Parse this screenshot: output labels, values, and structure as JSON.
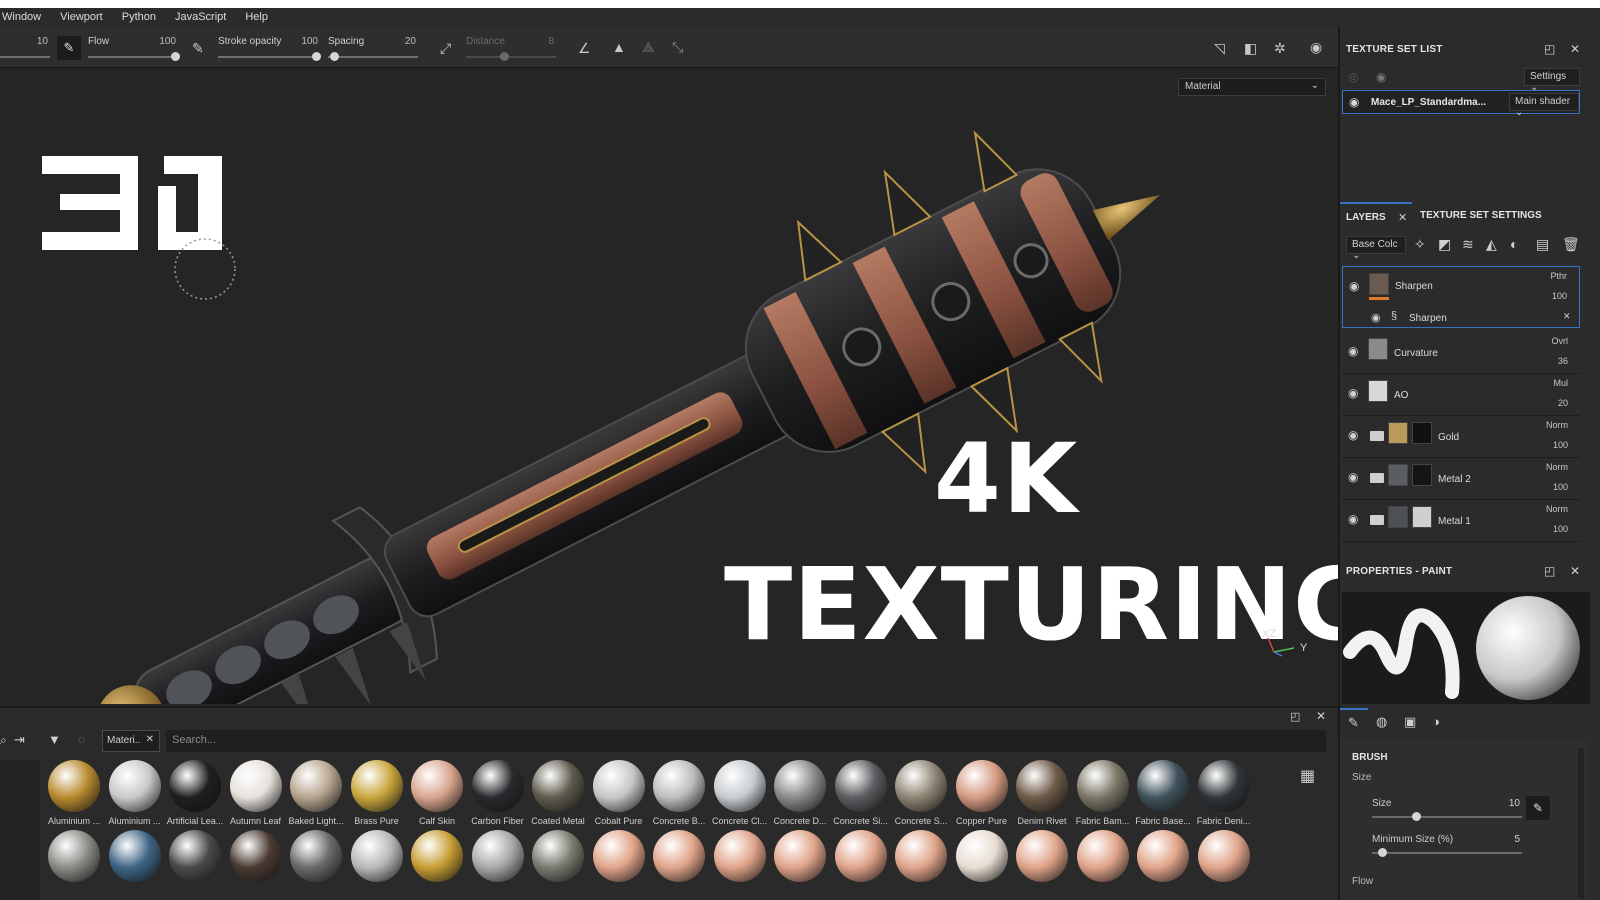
{
  "menu": [
    "Window",
    "Viewport",
    "Python",
    "JavaScript",
    "Help"
  ],
  "toolbar": {
    "size_value": "10",
    "flow_label": "Flow",
    "flow_value": "100",
    "stroke_label": "Stroke opacity",
    "stroke_value": "100",
    "spacing_label": "Spacing",
    "spacing_value": "20",
    "distance_label": "Distance",
    "distance_value": "8"
  },
  "viewport": {
    "display_select": "Material",
    "logo": "≡ [",
    "headline_1": "4K",
    "headline_2": "TEXTURING",
    "axis_label": "Y",
    "axis_label_2": "XZ"
  },
  "texture_set_list": {
    "title": "TEXTURE SET LIST",
    "settings_button": "Settings",
    "set_name": "Mace_LP_Standardma...",
    "shader": "Main shader"
  },
  "layers_panel": {
    "tab_layers": "LAYERS",
    "tab_settings": "TEXTURE SET SETTINGS",
    "channel_select": "Base Colc",
    "layers": [
      {
        "name": "Sharpen",
        "blend": "Pthr",
        "opacity": "100",
        "sub": "Sharpen"
      },
      {
        "name": "Curvature",
        "blend": "Ovrl",
        "opacity": "36"
      },
      {
        "name": "AO",
        "blend": "Mul",
        "opacity": "20"
      },
      {
        "name": "Gold",
        "blend": "Norm",
        "opacity": "100"
      },
      {
        "name": "Metal 2",
        "blend": "Norm",
        "opacity": "100"
      },
      {
        "name": "Metal 1",
        "blend": "Norm",
        "opacity": "100"
      }
    ]
  },
  "properties": {
    "title": "PROPERTIES - PAINT",
    "section": "BRUSH",
    "size_group": "Size",
    "size_label": "Size",
    "size_value": "10",
    "min_size_label": "Minimum Size (%)",
    "min_size_value": "5",
    "flow_label": "Flow"
  },
  "shelf": {
    "tab_label": "Materi..",
    "search_placeholder": "Search...",
    "materials": [
      {
        "name": "Aluminium ...",
        "color": "#b88a2e"
      },
      {
        "name": "Aluminium ...",
        "color": "#c9c9c9"
      },
      {
        "name": "Artificial Lea...",
        "color": "#1f1f1f"
      },
      {
        "name": "Autumn Leaf",
        "color": "#e6e0da"
      },
      {
        "name": "Baked Light...",
        "color": "#b6a48e"
      },
      {
        "name": "Brass Pure",
        "color": "#c9a63c"
      },
      {
        "name": "Calf Skin",
        "color": "#d9a58e"
      },
      {
        "name": "Carbon Fiber",
        "color": "#2a2a2e"
      },
      {
        "name": "Coated Metal",
        "color": "#5f5b4e"
      },
      {
        "name": "Cobalt Pure",
        "color": "#c5c5c8"
      },
      {
        "name": "Concrete B...",
        "color": "#bdbdbd"
      },
      {
        "name": "Concrete Cl...",
        "color": "#c6ccd0"
      },
      {
        "name": "Concrete D...",
        "color": "#8a8a8a"
      },
      {
        "name": "Concrete Si...",
        "color": "#5b5d60"
      },
      {
        "name": "Concrete S...",
        "color": "#8e8574"
      },
      {
        "name": "Copper Pure",
        "color": "#d59a82"
      },
      {
        "name": "Denim Rivet",
        "color": "#6e5b48"
      },
      {
        "name": "Fabric Bam...",
        "color": "#7c7766"
      },
      {
        "name": "Fabric Base...",
        "color": "#40535c"
      },
      {
        "name": "Fabric Deni...",
        "color": "#2f3538"
      }
    ],
    "row2_colors": [
      "#8a8a86",
      "#3f6584",
      "#4a4a48",
      "#4a3a32",
      "#6a6a6a",
      "#b8b8b8",
      "#c79e34",
      "#a8a8a8",
      "#7a7a70",
      "#e0a48a",
      "#e0a48a",
      "#e0a48a",
      "#e0a48a",
      "#e0a48a",
      "#e0a48a",
      "#e8dcd2",
      "#e0a48a",
      "#e0a48a",
      "#e0a48a",
      "#e0a48a"
    ]
  }
}
